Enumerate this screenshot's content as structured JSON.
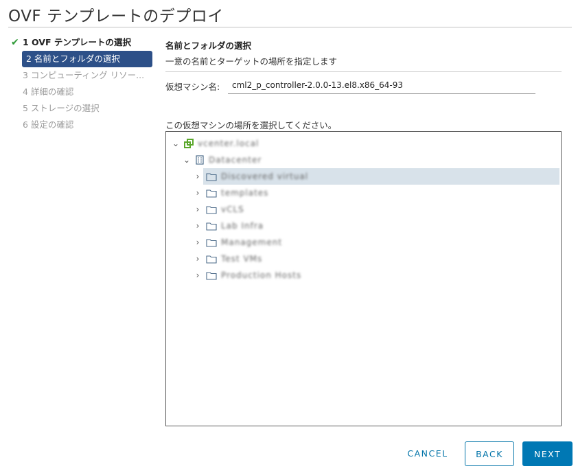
{
  "dialog": {
    "title": "OVF テンプレートのデプロイ"
  },
  "steps": [
    {
      "label": "1 OVF テンプレートの選択"
    },
    {
      "label": "2 名前とフォルダの選択"
    },
    {
      "label": "3 コンピューティング リソー..."
    },
    {
      "label": "4 詳細の確認"
    },
    {
      "label": "5 ストレージの選択"
    },
    {
      "label": "6 設定の確認"
    }
  ],
  "section": {
    "title": "名前とフォルダの選択",
    "description": "一意の名前とターゲットの場所を指定します"
  },
  "vm_name": {
    "label": "仮想マシン名:",
    "value": "cml2_p_controller-2.0.0-13.el8.x86_64-93"
  },
  "location": {
    "label": "この仮想マシンの場所を選択してください。"
  },
  "tree": {
    "root": "vcenter.local",
    "datacenter": "Datacenter",
    "folders": [
      "Discovered virtual",
      "templates",
      "vCLS",
      "Lab Infra",
      "Management",
      "Test VMs",
      "Production Hosts"
    ]
  },
  "buttons": {
    "cancel": "CANCEL",
    "back": "BACK",
    "next": "NEXT"
  },
  "colors": {
    "accent": "#0078b4",
    "active_step": "#2d5088",
    "check": "#2e9a37",
    "selected_row": "#d8e2ea"
  }
}
